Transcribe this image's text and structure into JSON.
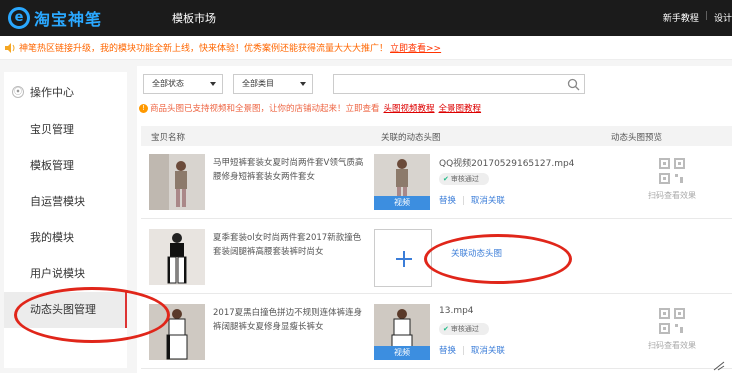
{
  "topbar": {
    "logo_glyph": "e",
    "logo_text": "淘宝神笔",
    "market": "模板市场",
    "tutorial": "新手教程",
    "design": "设计",
    "sep": "|"
  },
  "notice": {
    "text": "神笔热区链接升级，我的模块功能全新上线，快来体验！优秀案例还能获得流量大大大推广！",
    "link": "立即查看>>"
  },
  "sidebar": {
    "header": "操作中心",
    "items": [
      {
        "label": "宝贝管理"
      },
      {
        "label": "模板管理"
      },
      {
        "label": "自运营模块"
      },
      {
        "label": "我的模块"
      },
      {
        "label": "用户说模块"
      },
      {
        "label": "动态头图管理",
        "active": true
      }
    ]
  },
  "filters": {
    "status": "全部状态",
    "category": "全部类目",
    "search_value": ""
  },
  "info": {
    "text": "商品头图已支持视频和全景图，让你的店铺动起来！立即查看",
    "link_video": "头图视频教程",
    "link_pano": "全景图教程"
  },
  "table": {
    "headers": [
      "宝贝名称",
      "关联的动态头图",
      "动态头图预览"
    ],
    "rows": [
      {
        "title": "马甲短裤套装女夏时尚两件套V领气质高腰修身短裤套装女两件套女",
        "filename": "QQ视频20170529165127.mp4",
        "audit": "审核通过",
        "video_tag": "视频",
        "replace": "替换",
        "cancel": "取消关联",
        "scan": "扫码查看效果"
      },
      {
        "title": "夏季套装ol女时尚两件套2017新款撞色套装阔腿裤高腰套装裤时尚女",
        "link_assoc": "关联动态头图"
      },
      {
        "title": "2017夏黑白撞色拼边不规则连体裤连身裤阔腿裤女夏修身显瘦长裤女",
        "filename": "13.mp4",
        "audit": "审核通过",
        "video_tag": "视频",
        "replace": "替换",
        "cancel": "取消关联",
        "scan": "扫码查看效果"
      }
    ]
  },
  "colors": {
    "topbar": "#1b1b1b",
    "brand": "#2aa8ff",
    "link": "#3b7dd8",
    "annotation": "#e0261a",
    "notice": "#ff6600"
  }
}
